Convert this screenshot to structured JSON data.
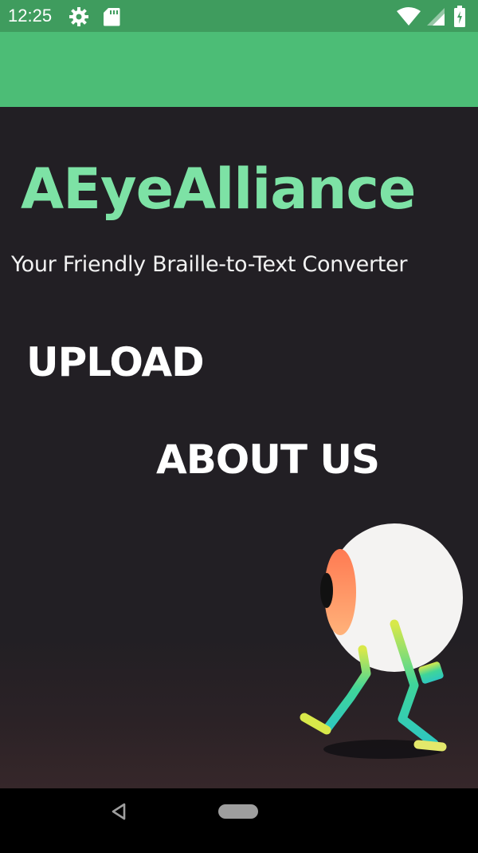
{
  "status_bar": {
    "time": "12:25",
    "icons": [
      "gear-icon",
      "sd-card-icon",
      "wifi-icon",
      "signal-icon",
      "battery-icon"
    ]
  },
  "app": {
    "title": "AEyeAlliance",
    "subtitle": "Your Friendly Braille-to-Text Converter"
  },
  "menu": {
    "upload_label": "UPLOAD",
    "about_label": "ABOUT US"
  },
  "colors": {
    "status_bar": "#3f9c5e",
    "app_bar": "#4cbd76",
    "title": "#7de2a5",
    "background": "#221f24"
  },
  "nav_bar": {
    "icons": [
      "back-icon",
      "home-pill-icon"
    ]
  }
}
